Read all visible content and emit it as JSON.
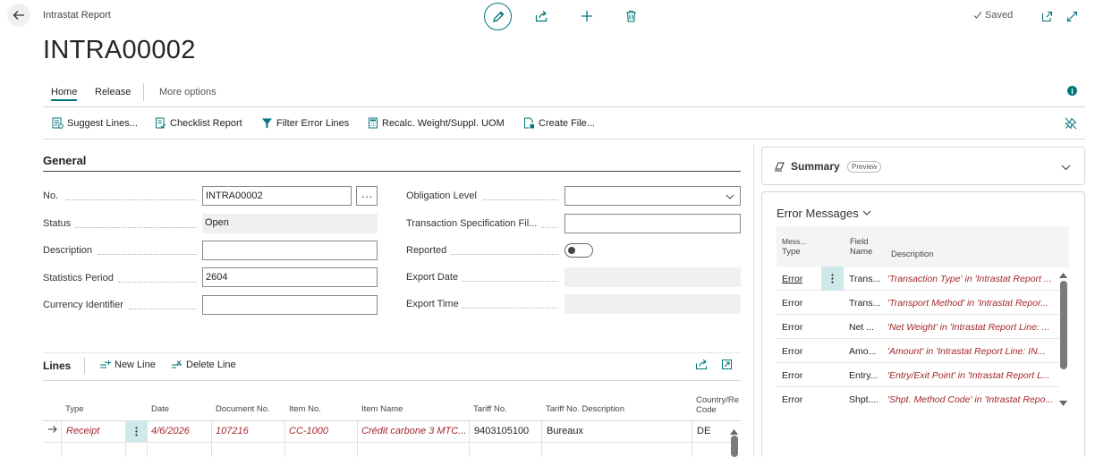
{
  "header": {
    "breadcrumb": "Intrastat Report",
    "title": "INTRA00002",
    "saved_label": "Saved"
  },
  "tabs": [
    {
      "label": "Home"
    },
    {
      "label": "Release"
    },
    {
      "label": "More options"
    }
  ],
  "actions": [
    {
      "label": "Suggest Lines...",
      "icon": "suggest-lines-icon"
    },
    {
      "label": "Checklist Report",
      "icon": "checklist-report-icon"
    },
    {
      "label": "Filter Error Lines",
      "icon": "filter-icon"
    },
    {
      "label": "Recalc. Weight/Suppl. UOM",
      "icon": "calculator-icon"
    },
    {
      "label": "Create File...",
      "icon": "create-file-icon"
    }
  ],
  "general": {
    "title": "General",
    "no_label": "No.",
    "no_value": "INTRA00002",
    "status_label": "Status",
    "status_value": "Open",
    "description_label": "Description",
    "description_value": "",
    "statistics_period_label": "Statistics Period",
    "statistics_period_value": "2604",
    "currency_identifier_label": "Currency Identifier",
    "currency_identifier_value": "",
    "obligation_level_label": "Obligation Level",
    "obligation_level_value": "",
    "transaction_spec_label": "Transaction Specification Fil...",
    "transaction_spec_value": "",
    "reported_label": "Reported",
    "reported_value": false,
    "export_date_label": "Export Date",
    "export_time_label": "Export Time",
    "ellipsis": "···"
  },
  "lines": {
    "title": "Lines",
    "new_line_label": "New Line",
    "delete_line_label": "Delete Line",
    "columns": [
      "Type",
      "Date",
      "Document No.",
      "Item No.",
      "Item Name",
      "Tariff No.",
      "Tariff No. Description",
      "Country/Region Code"
    ],
    "rows": [
      {
        "type": "Receipt",
        "date": "4/6/2026",
        "document_no": "107216",
        "item_no": "CC-1000",
        "item_name": "Crédit carbone 3 MTC...",
        "tariff_no": "9403105100",
        "tariff_desc": "Bureaux",
        "country": "DE"
      }
    ]
  },
  "summary": {
    "title": "Summary",
    "badge": "Preview"
  },
  "error_messages": {
    "title": "Error Messages",
    "col_type_1": "Mess...",
    "col_type_2": "Type",
    "col_field_1": "Field",
    "col_field_2": "Name",
    "col_description": "Description",
    "rows": [
      {
        "type": "Error",
        "field": "Trans...",
        "message": "'Transaction Type' in 'Intrastat Report ..."
      },
      {
        "type": "Error",
        "field": "Trans...",
        "message": "'Transport Method' in 'Intrastat Repor..."
      },
      {
        "type": "Error",
        "field": "Net ...",
        "message": "'Net Weight' in 'Intrastat Report Line: ..."
      },
      {
        "type": "Error",
        "field": "Amo...",
        "message": "'Amount' in 'Intrastat Report Line: IN..."
      },
      {
        "type": "Error",
        "field": "Entry...",
        "message": "'Entry/Exit Point' in 'Intrastat Report L..."
      },
      {
        "type": "Error",
        "field": "Shpt....",
        "message": "'Shpt. Method Code' in 'Intrastat Repo..."
      }
    ]
  },
  "colors": {
    "accent": "#00767a",
    "error_text": "#a4262c"
  }
}
